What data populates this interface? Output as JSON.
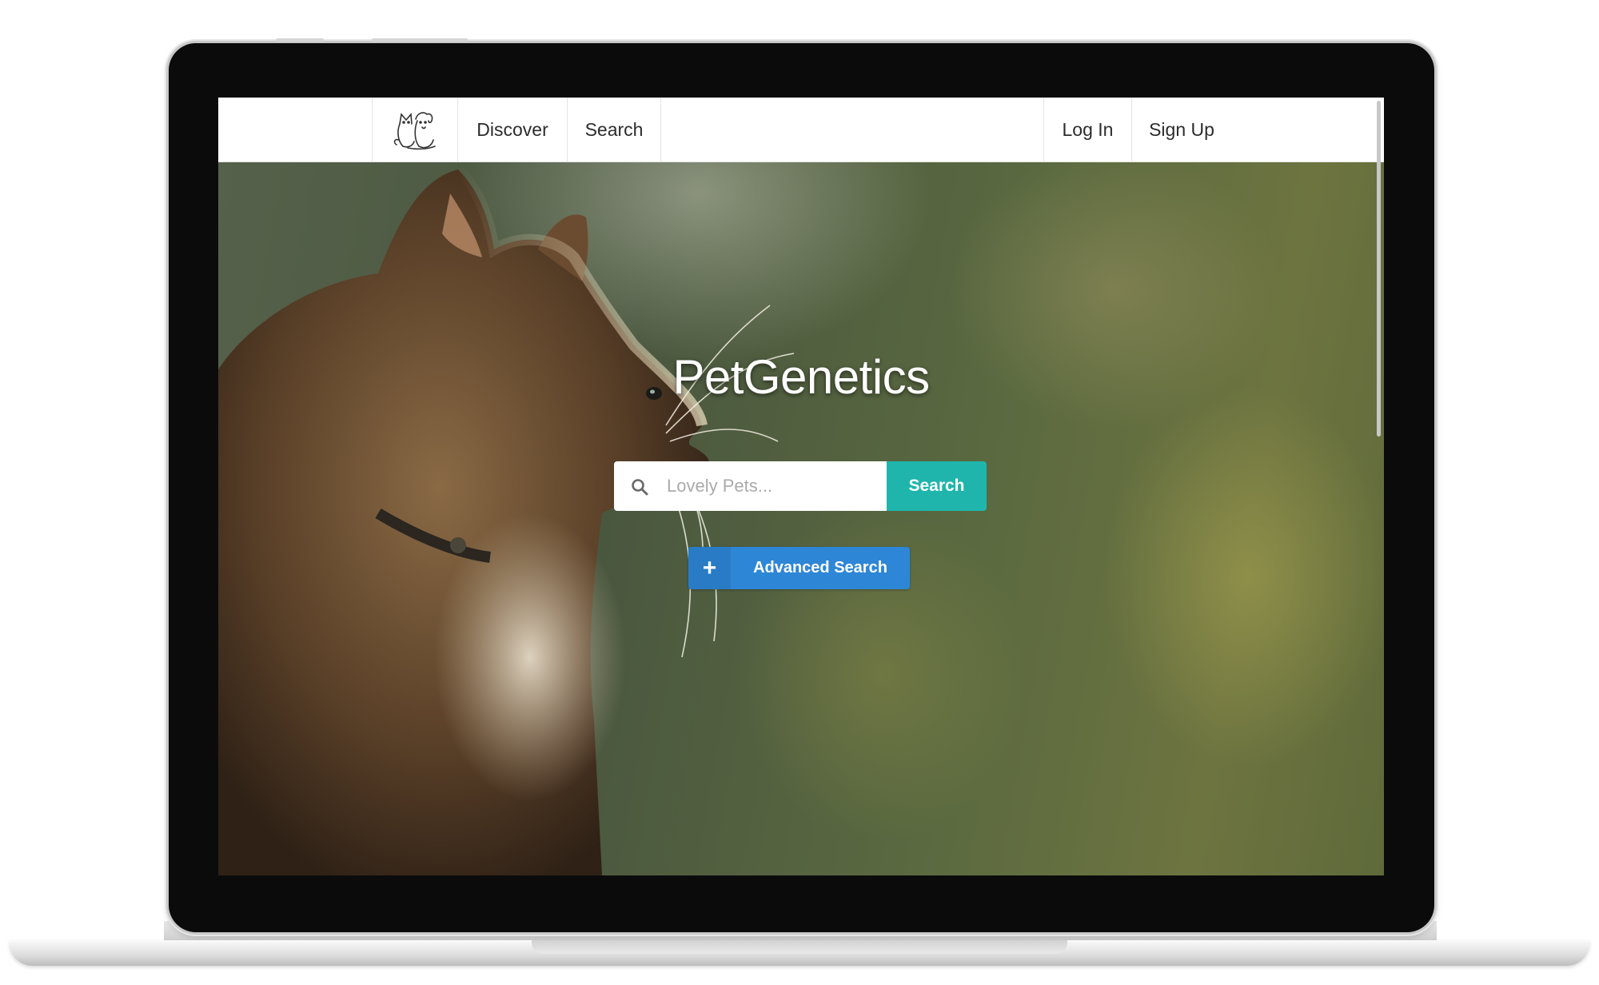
{
  "navbar": {
    "logo_icon": "cat-and-dog-logo-icon",
    "items": [
      {
        "label": "Discover"
      },
      {
        "label": "Search"
      }
    ],
    "right_items": [
      {
        "label": "Log In"
      },
      {
        "label": "Sign Up"
      }
    ]
  },
  "hero": {
    "title": "PetGenetics",
    "search": {
      "placeholder": "Lovely Pets...",
      "value": "",
      "button_label": "Search",
      "icon": "search-icon"
    },
    "advanced_search": {
      "icon": "plus-icon",
      "label": "Advanced Search"
    }
  },
  "colors": {
    "search_button": "#1fb5ac",
    "advanced_button": "#2e86d6",
    "navbar_bg": "#ffffff"
  }
}
